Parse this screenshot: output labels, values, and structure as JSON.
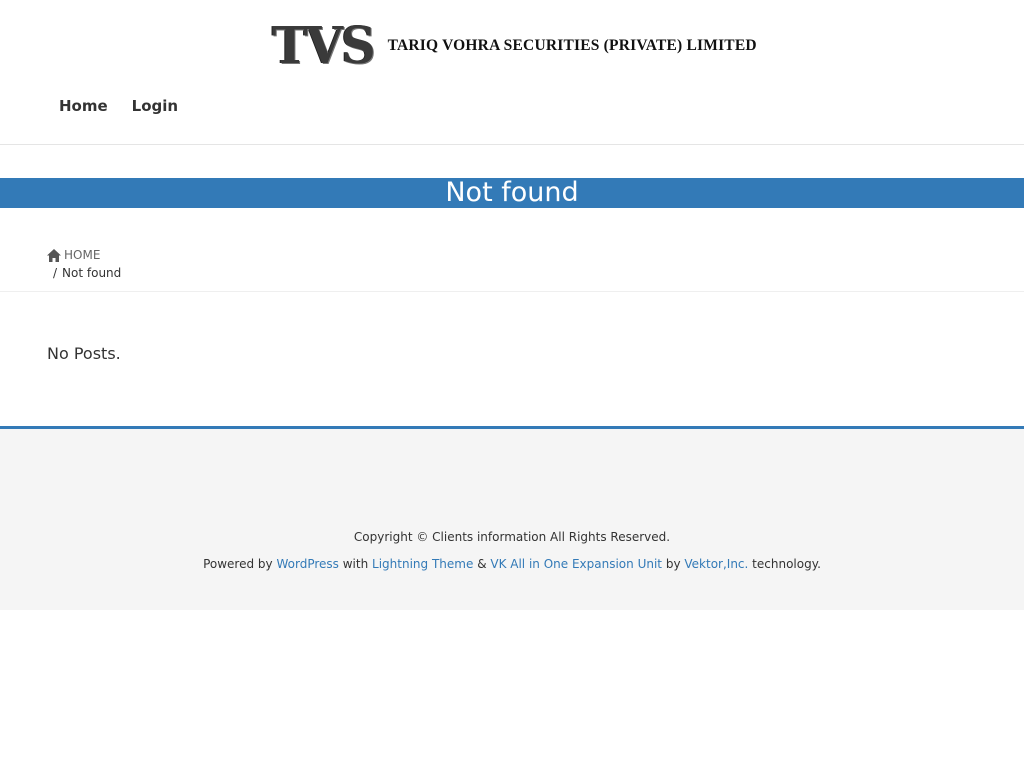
{
  "header": {
    "logo_mark": "TVS",
    "logo_text": "TARIQ VOHRA SECURITIES (PRIVATE) LIMITED",
    "nav": [
      {
        "label": "Home"
      },
      {
        "label": "Login"
      }
    ]
  },
  "page": {
    "title": "Not found",
    "breadcrumb": {
      "home": "HOME",
      "separator": "/",
      "current": "Not found"
    },
    "message": "No Posts."
  },
  "footer": {
    "copyright": "Copyright © Clients information All Rights Reserved.",
    "powered": {
      "prefix": "Powered by",
      "wordpress": "WordPress",
      "with": "with",
      "theme": "Lightning Theme",
      "amp": "&",
      "plugin": "VK All in One Expansion Unit",
      "by": "by",
      "vendor": "Vektor,Inc.",
      "suffix": "technology."
    }
  },
  "colors": {
    "accent": "#337ab7",
    "footer_bg": "#f5f5f5"
  }
}
